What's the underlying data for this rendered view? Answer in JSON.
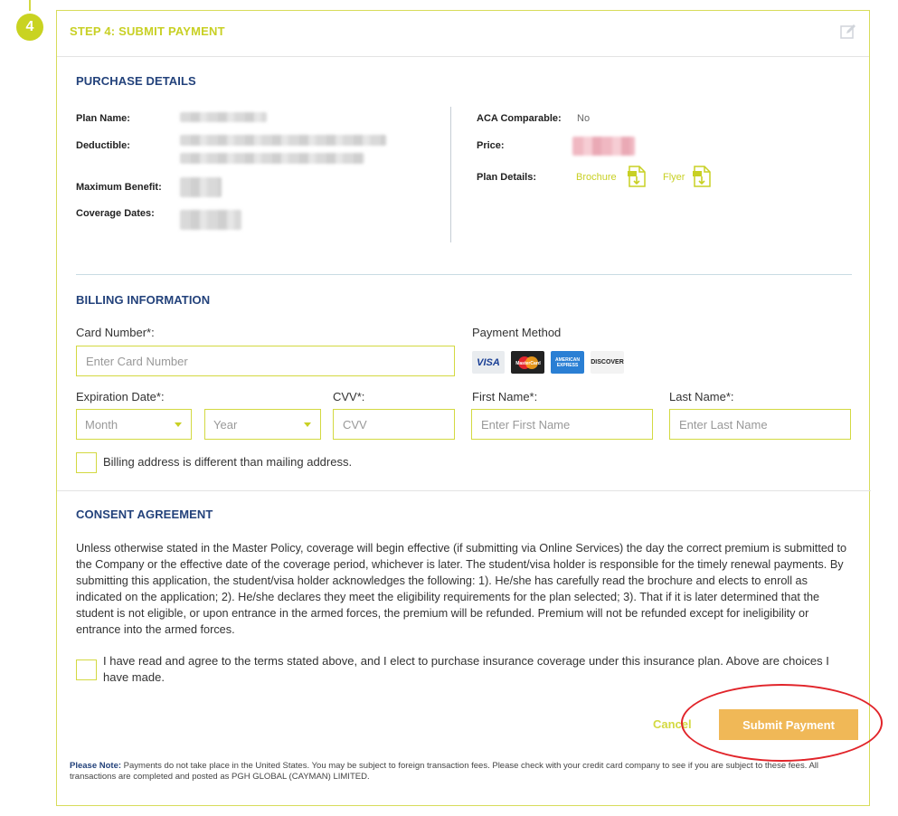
{
  "step": {
    "number": "4",
    "title": "STEP 4: SUBMIT PAYMENT"
  },
  "purchase": {
    "title": "PURCHASE DETAILS",
    "plan_name_label": "Plan Name:",
    "deductible_label": "Deductible:",
    "max_benefit_label": "Maximum Benefit:",
    "coverage_dates_label": "Coverage Dates:",
    "aca_label": "ACA Comparable:",
    "aca_value": "No",
    "price_label": "Price:",
    "plan_details_label": "Plan Details:",
    "brochure_label": "Brochure",
    "flyer_label": "Flyer"
  },
  "billing": {
    "title": "BILLING INFORMATION",
    "card_number_label": "Card Number*:",
    "card_number_placeholder": "Enter Card Number",
    "payment_method_label": "Payment Method",
    "cards": [
      "VISA",
      "MasterCard",
      "AMERICAN EXPRESS",
      "DISCOVER"
    ],
    "expiration_label": "Expiration Date*:",
    "month_placeholder": "Month",
    "year_placeholder": "Year",
    "cvv_label": "CVV*:",
    "cvv_placeholder": "CVV",
    "first_name_label": "First Name*:",
    "first_name_placeholder": "Enter First Name",
    "last_name_label": "Last Name*:",
    "last_name_placeholder": "Enter Last Name",
    "billing_diff_label": "Billing address is different than mailing address."
  },
  "consent": {
    "title": "CONSENT AGREEMENT",
    "text": "Unless otherwise stated in the Master Policy, coverage will begin effective (if submitting via Online Services) the day the correct premium is submitted to the Company or the effective date of the coverage period, whichever is later. The student/visa holder is responsible for the timely renewal payments. By submitting this application, the student/visa holder acknowledges the following: 1). He/she has carefully read the brochure and elects to enroll as indicated on the application; 2). He/she declares they meet the eligibility requirements for the plan selected; 3). That if it is later determined that the student is not eligible, or upon entrance in the armed forces, the premium will be refunded. Premium will not be refunded except for ineligibility or entrance into the armed forces.",
    "agree_label": "I have read and agree to the terms stated above, and I elect to purchase insurance coverage under this insurance plan. Above are choices I have made."
  },
  "actions": {
    "cancel_label": "Cancel",
    "submit_label": "Submit Payment"
  },
  "note": {
    "prefix": "Please Note:",
    "text": " Payments do not take place in the United States. You may be subject to foreign transaction fees. Please check with your credit card company to see if you are subject to these fees. All transactions are completed and posted as PGH GLOBAL (CAYMAN) LIMITED."
  },
  "colors": {
    "accent": "#c8d024",
    "heading": "#23427b",
    "submit": "#f0b857",
    "highlight": "#e1242a"
  }
}
